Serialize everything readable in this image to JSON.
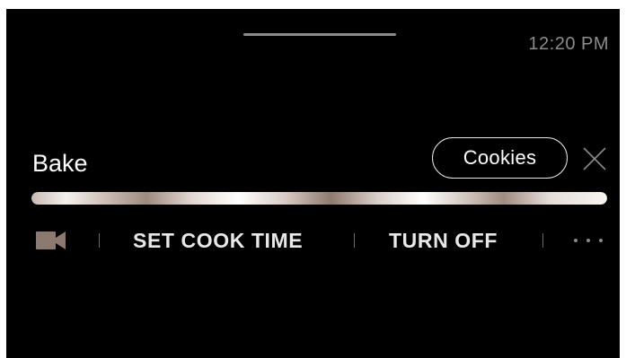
{
  "status_bar": {
    "time": "12:20 PM"
  },
  "cook_mode": {
    "title": "Bake",
    "recipe_label": "Cookies",
    "progress": 1.0
  },
  "actions": {
    "set_cook_time_label": "SET COOK TIME",
    "turn_off_label": "TURN OFF"
  },
  "icons": {
    "camera": "video-camera-icon",
    "close": "close-icon",
    "more": "more-options-icon"
  },
  "colors": {
    "background": "#000000",
    "accent": "#8c7a70",
    "text": "#ffffff",
    "muted": "#8c8c8c"
  }
}
